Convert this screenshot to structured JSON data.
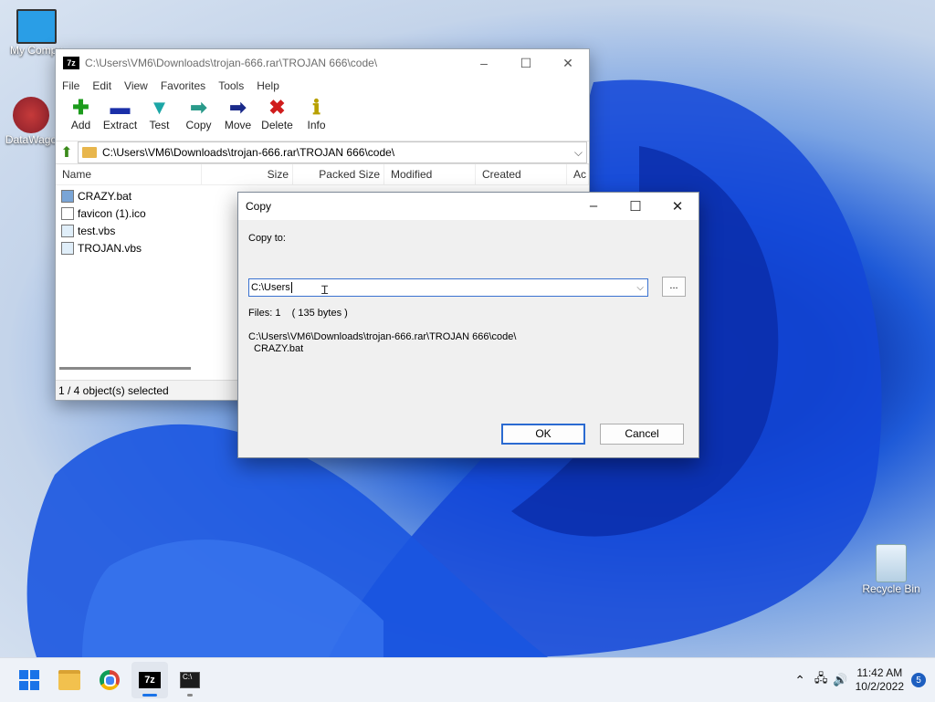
{
  "desktop": {
    "icons": [
      {
        "label": "My Compu"
      },
      {
        "label": "DataWago"
      },
      {
        "label": "Recycle Bin"
      }
    ]
  },
  "filemanager": {
    "title": "C:\\Users\\VM6\\Downloads\\trojan-666.rar\\TROJAN 666\\code\\",
    "menu": [
      "File",
      "Edit",
      "View",
      "Favorites",
      "Tools",
      "Help"
    ],
    "toolbar": [
      "Add",
      "Extract",
      "Test",
      "Copy",
      "Move",
      "Delete",
      "Info"
    ],
    "address": "C:\\Users\\VM6\\Downloads\\trojan-666.rar\\TROJAN 666\\code\\",
    "columns": [
      "Name",
      "Size",
      "Packed Size",
      "Modified",
      "Created",
      "Ac"
    ],
    "files": [
      {
        "name": "CRAZY.bat",
        "type": "bat"
      },
      {
        "name": "favicon (1).ico",
        "type": "ico"
      },
      {
        "name": "test.vbs",
        "type": "vbs"
      },
      {
        "name": "TROJAN.vbs",
        "type": "vbs"
      }
    ],
    "status": "1 / 4 object(s) selected"
  },
  "dialog": {
    "title": "Copy",
    "copy_to_label": "Copy to:",
    "copy_to_value": "C:\\Users",
    "browse_label": "...",
    "files_info": "Files: 1    ( 135 bytes )",
    "source_path": "C:\\Users\\VM6\\Downloads\\trojan-666.rar\\TROJAN 666\\code\\",
    "source_file": "CRAZY.bat",
    "ok_label": "OK",
    "cancel_label": "Cancel"
  },
  "taskbar": {
    "time": "11:42 AM",
    "date": "10/2/2022",
    "notifications": "5",
    "apps": [
      "start-icon",
      "file-explorer-icon",
      "chrome-icon",
      "7zip-icon",
      "terminal-icon"
    ]
  },
  "colors": {
    "accent": "#2a6ad1",
    "wallpaper_blue": "#0a3fd6"
  }
}
